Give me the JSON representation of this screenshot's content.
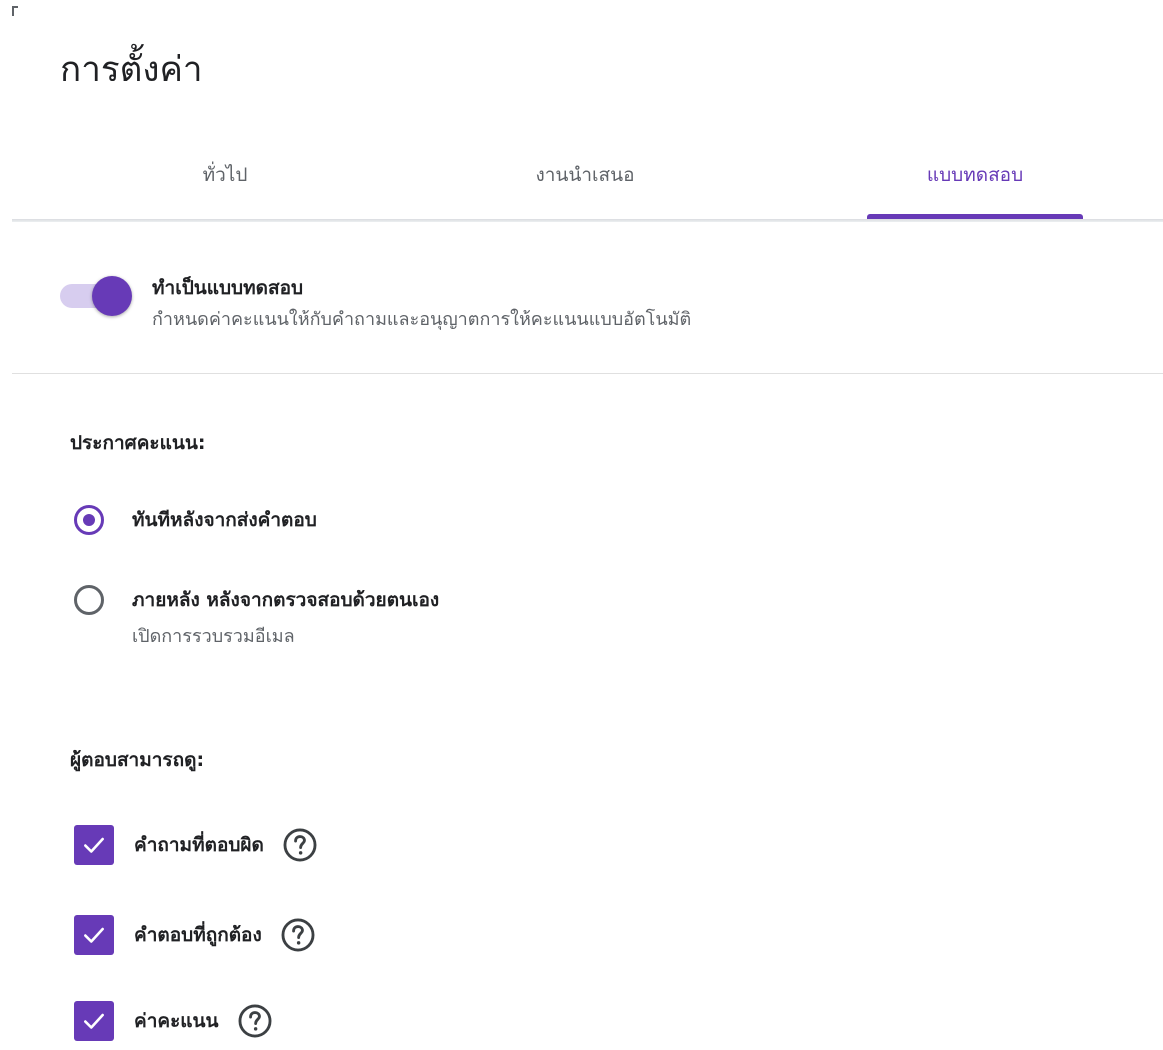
{
  "dialog": {
    "title": "การตั้งค่า"
  },
  "tabs": [
    {
      "label": "ทั่วไป",
      "selected": false
    },
    {
      "label": "งานนำเสนอ",
      "selected": false
    },
    {
      "label": "แบบทดสอบ",
      "selected": true
    }
  ],
  "quiz_toggle": {
    "label": "ทำเป็นแบบทดสอบ",
    "description": "กำหนดค่าคะแนนให้กับคำถามและอนุญาตการให้คะแนนแบบอัตโนมัติ",
    "on": true
  },
  "release_grade": {
    "title": "ประกาศคะแนน:",
    "options": [
      {
        "label": "ทันทีหลังจากส่งคำตอบ",
        "sub": "",
        "selected": true
      },
      {
        "label": "ภายหลัง หลังจากตรวจสอบด้วยตนเอง",
        "sub": "เปิดการรวบรวมอีเมล",
        "selected": false
      }
    ]
  },
  "respondent_can_see": {
    "title": "ผู้ตอบสามารถดู:",
    "options": [
      {
        "label": "คำถามที่ตอบผิด",
        "checked": true,
        "icon": "help-circle-icon"
      },
      {
        "label": "คำตอบที่ถูกต้อง",
        "checked": true,
        "icon": "help-circle-icon"
      },
      {
        "label": "ค่าคะแนน",
        "checked": true,
        "icon": "help-circle-icon"
      }
    ]
  },
  "colors": {
    "accent": "#673ab7",
    "accent_light": "#d7cdef",
    "text_primary": "#202124",
    "text_secondary": "#5f6368"
  }
}
